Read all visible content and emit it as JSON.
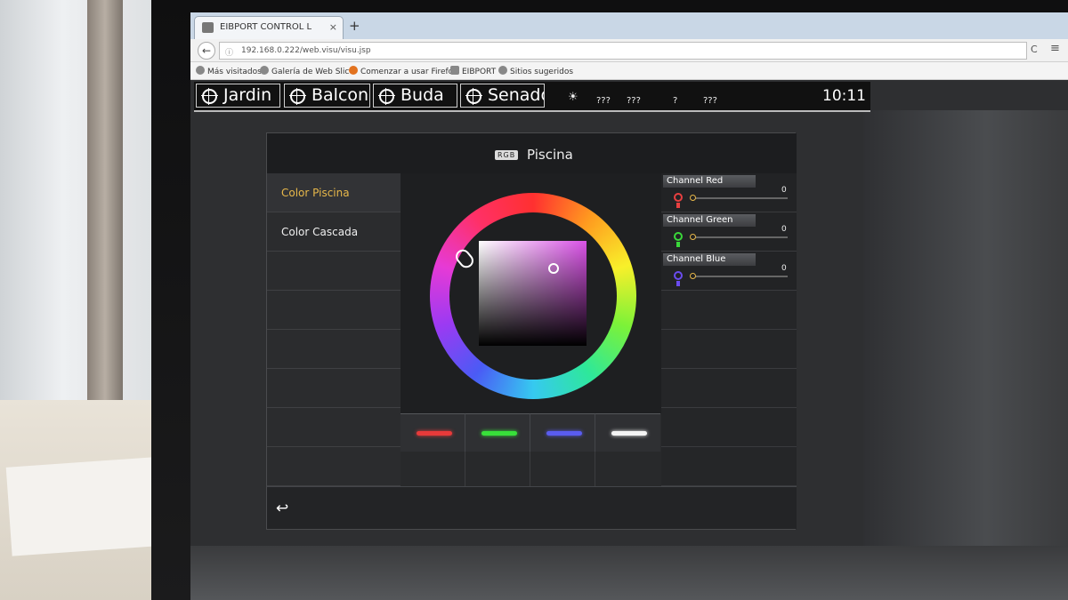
{
  "browser": {
    "tab_title": "EIBPORT CONTROL L",
    "tab_close": "×",
    "new_tab": "+",
    "back": "←",
    "url_info": "ⓘ",
    "url": "192.168.0.222/web.visu/visu.jsp",
    "reload": "C",
    "menu": "≡",
    "bookmarks": [
      "Más visitados",
      "Galería de Web Slice",
      "Comenzar a usar Firefox",
      "EIBPORT",
      "Sitios sugeridos"
    ]
  },
  "visu_header": {
    "rooms": [
      "Jardin",
      "Balcon",
      "Buda",
      "Senador"
    ],
    "weather_icon": "weather-icon",
    "weather_values": [
      "???",
      "???",
      "?",
      "???"
    ],
    "clock": "10:11"
  },
  "panel": {
    "badge": "RGB",
    "title": "Piscina",
    "menu_items": [
      "Color Piscina",
      "Color Cascada"
    ],
    "active_menu": "Color Piscina",
    "channels": [
      {
        "label": "Channel Red",
        "value": "0",
        "color": "#e84040"
      },
      {
        "label": "Channel Green",
        "value": "0",
        "color": "#3ad83a"
      },
      {
        "label": "Channel Blue",
        "value": "0",
        "color": "#6a4cf0"
      }
    ],
    "presets": [
      {
        "name": "red",
        "color": "#e83a3a"
      },
      {
        "name": "green",
        "color": "#38e03a"
      },
      {
        "name": "blue",
        "color": "#5a5cf0"
      },
      {
        "name": "white",
        "color": "#f4f4f4"
      }
    ],
    "back_glyph": "↩"
  },
  "colors": {
    "accent": "#e8b84a",
    "panel_bg": "#2a2b2d",
    "selected_color": "#d952e6"
  }
}
